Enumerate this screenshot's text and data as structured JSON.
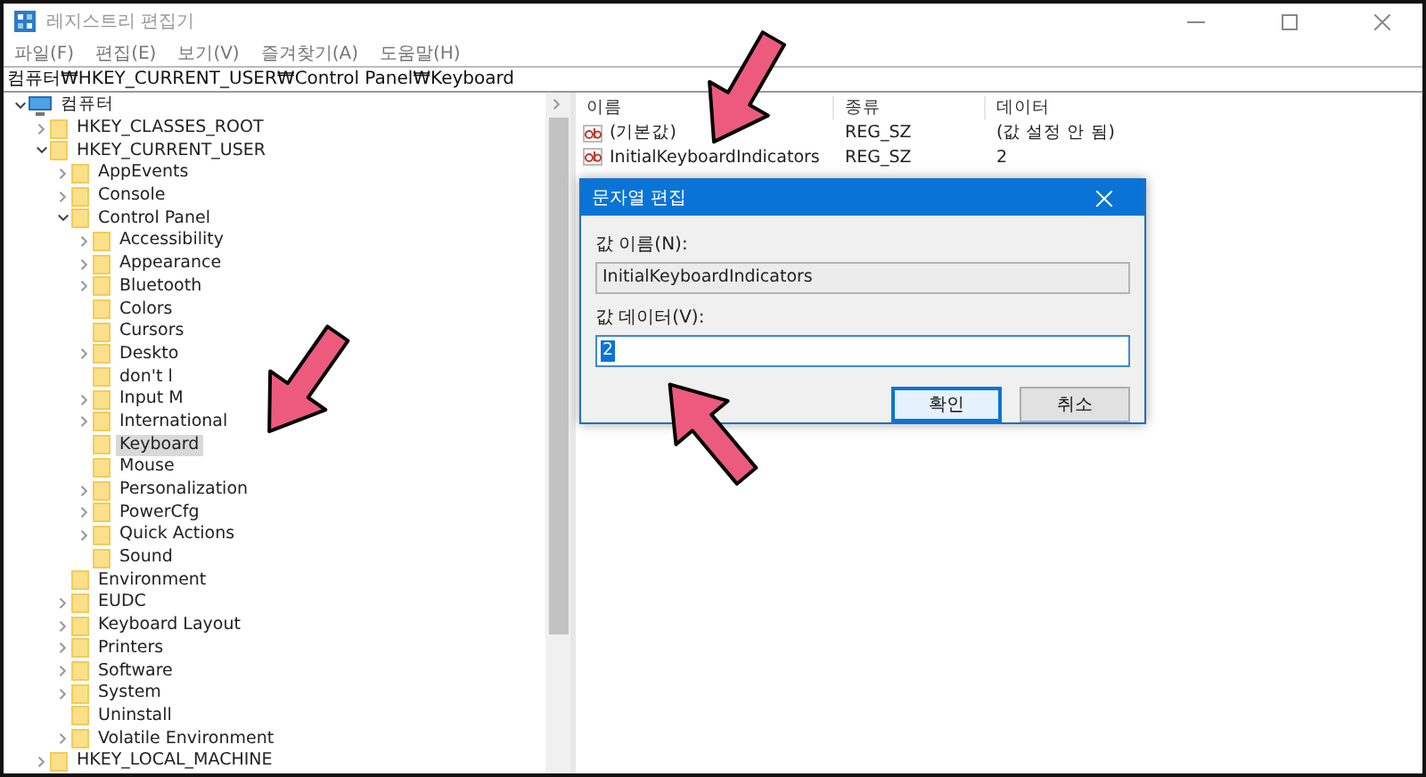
{
  "window": {
    "title": "레지스트리 편집기"
  },
  "menu": [
    "파일(F)",
    "편집(E)",
    "보기(V)",
    "즐겨찾기(A)",
    "도움말(H)"
  ],
  "address": "컴퓨터₩HKEY_CURRENT_USER₩Control Panel₩Keyboard",
  "tree": {
    "label": "컴퓨터",
    "expanded": true,
    "children": [
      {
        "label": "HKEY_CLASSES_ROOT",
        "has_children": true,
        "expanded": false,
        "selected": false
      },
      {
        "label": "HKEY_CURRENT_USER",
        "has_children": true,
        "expanded": true,
        "selected": false,
        "children": [
          {
            "label": "AppEvents",
            "has_children": true,
            "expanded": false,
            "selected": false
          },
          {
            "label": "Console",
            "has_children": true,
            "expanded": false,
            "selected": false
          },
          {
            "label": "Control Panel",
            "has_children": true,
            "expanded": true,
            "selected": false,
            "children": [
              {
                "label": "Accessibility",
                "has_children": true,
                "expanded": false,
                "selected": false
              },
              {
                "label": "Appearance",
                "has_children": true,
                "expanded": false,
                "selected": false
              },
              {
                "label": "Bluetooth",
                "has_children": true,
                "expanded": false,
                "selected": false
              },
              {
                "label": "Colors",
                "has_children": false,
                "expanded": false,
                "selected": false
              },
              {
                "label": "Cursors",
                "has_children": false,
                "expanded": false,
                "selected": false
              },
              {
                "label": "Deskto",
                "has_children": true,
                "expanded": false,
                "selected": false
              },
              {
                "label": "don't l",
                "has_children": false,
                "expanded": false,
                "selected": false
              },
              {
                "label": "Input M",
                "has_children": true,
                "expanded": false,
                "selected": false
              },
              {
                "label": "International",
                "has_children": true,
                "expanded": false,
                "selected": false
              },
              {
                "label": "Keyboard",
                "has_children": false,
                "expanded": false,
                "selected": true
              },
              {
                "label": "Mouse",
                "has_children": false,
                "expanded": false,
                "selected": false
              },
              {
                "label": "Personalization",
                "has_children": true,
                "expanded": false,
                "selected": false
              },
              {
                "label": "PowerCfg",
                "has_children": true,
                "expanded": false,
                "selected": false
              },
              {
                "label": "Quick Actions",
                "has_children": true,
                "expanded": false,
                "selected": false
              },
              {
                "label": "Sound",
                "has_children": false,
                "expanded": false,
                "selected": false
              }
            ]
          },
          {
            "label": "Environment",
            "has_children": false,
            "expanded": false,
            "selected": false
          },
          {
            "label": "EUDC",
            "has_children": true,
            "expanded": false,
            "selected": false
          },
          {
            "label": "Keyboard Layout",
            "has_children": true,
            "expanded": false,
            "selected": false
          },
          {
            "label": "Printers",
            "has_children": true,
            "expanded": false,
            "selected": false
          },
          {
            "label": "Software",
            "has_children": true,
            "expanded": false,
            "selected": false
          },
          {
            "label": "System",
            "has_children": true,
            "expanded": false,
            "selected": false
          },
          {
            "label": "Uninstall",
            "has_children": false,
            "expanded": false,
            "selected": false
          },
          {
            "label": "Volatile Environment",
            "has_children": true,
            "expanded": false,
            "selected": false
          }
        ]
      },
      {
        "label": "HKEY_LOCAL_MACHINE",
        "has_children": true,
        "expanded": false,
        "selected": false
      }
    ]
  },
  "table": {
    "columns": [
      "이름",
      "종류",
      "데이터"
    ],
    "rows": [
      {
        "name": "(기본값)",
        "type": "REG_SZ",
        "data": "(값 설정 안 됨)"
      },
      {
        "name": "InitialKeyboardIndicators",
        "type": "REG_SZ",
        "data": "2"
      }
    ]
  },
  "dialog": {
    "title": "문자열 편집",
    "name_label": "값 이름(N):",
    "name_value": "InitialKeyboardIndicators",
    "data_label": "값 데이터(V):",
    "data_value": "2",
    "data_selected": true,
    "buttons": [
      {
        "label": "확인",
        "default": true
      },
      {
        "label": "취소",
        "default": false
      }
    ]
  }
}
